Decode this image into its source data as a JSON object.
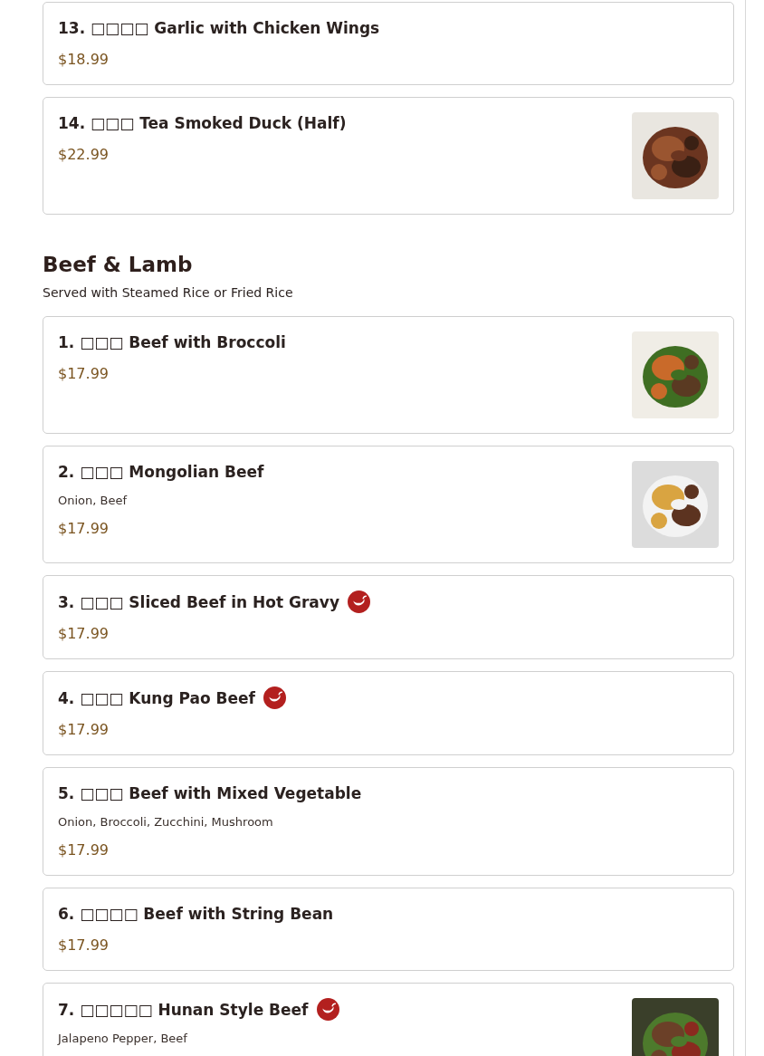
{
  "sections": [
    {
      "items": [
        {
          "name": "13. □□□□ Garlic with Chicken Wings",
          "price": "$18.99",
          "spicy": false
        },
        {
          "name": "14. □□□ Tea Smoked Duck (Half)",
          "price": "$22.99",
          "spicy": false
        }
      ]
    },
    {
      "title": "Beef & Lamb",
      "subtitle": "Served with Steamed Rice or Fried Rice",
      "items": [
        {
          "name": "1. □□□ Beef with Broccoli",
          "price": "$17.99",
          "spicy": false
        },
        {
          "name": "2. □□□ Mongolian Beef",
          "description": "Onion, Beef",
          "price": "$17.99",
          "spicy": false
        },
        {
          "name": "3. □□□ Sliced Beef in Hot Gravy",
          "price": "$17.99",
          "spicy": true
        },
        {
          "name": "4. □□□ Kung Pao Beef",
          "price": "$17.99",
          "spicy": true
        },
        {
          "name": "5. □□□ Beef with Mixed Vegetable",
          "description": "Onion, Broccoli, Zucchini, Mushroom",
          "price": "$17.99",
          "spicy": false
        },
        {
          "name": "6. □□□□ Beef with String Bean",
          "price": "$17.99",
          "spicy": false
        },
        {
          "name": "7. □□□□□ Hunan Style Beef",
          "description": "Jalapeno Pepper, Beef",
          "spicy": true
        }
      ]
    }
  ]
}
